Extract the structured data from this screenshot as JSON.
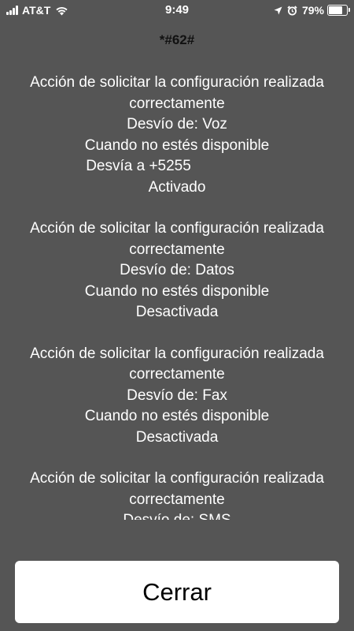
{
  "status_bar": {
    "carrier": "AT&T",
    "time": "9:49",
    "battery": "79%",
    "battery_level": 0.79,
    "icons": [
      "signal-icon",
      "wifi-icon",
      "location-icon",
      "alarm-icon",
      "battery-icon"
    ]
  },
  "dialog": {
    "title": "*#62#",
    "messages": [
      {
        "line1": "Acción de solicitar la configuración realizada",
        "line2": "correctamente",
        "line3": "Desvío de: Voz",
        "line4": "Cuando no estés disponible",
        "line5": "Desvía a +5255",
        "line6": "Activado"
      },
      {
        "line1": "Acción de solicitar la configuración realizada",
        "line2": "correctamente",
        "line3": "Desvío de: Datos",
        "line4": "Cuando no estés disponible",
        "line5": "Desactivada"
      },
      {
        "line1": "Acción de solicitar la configuración realizada",
        "line2": "correctamente",
        "line3": "Desvío de: Fax",
        "line4": "Cuando no estés disponible",
        "line5": "Desactivada"
      },
      {
        "line1": "Acción de solicitar la configuración realizada",
        "line2": "correctamente",
        "line3": "Desvío de: SMS"
      }
    ],
    "close_label": "Cerrar"
  }
}
